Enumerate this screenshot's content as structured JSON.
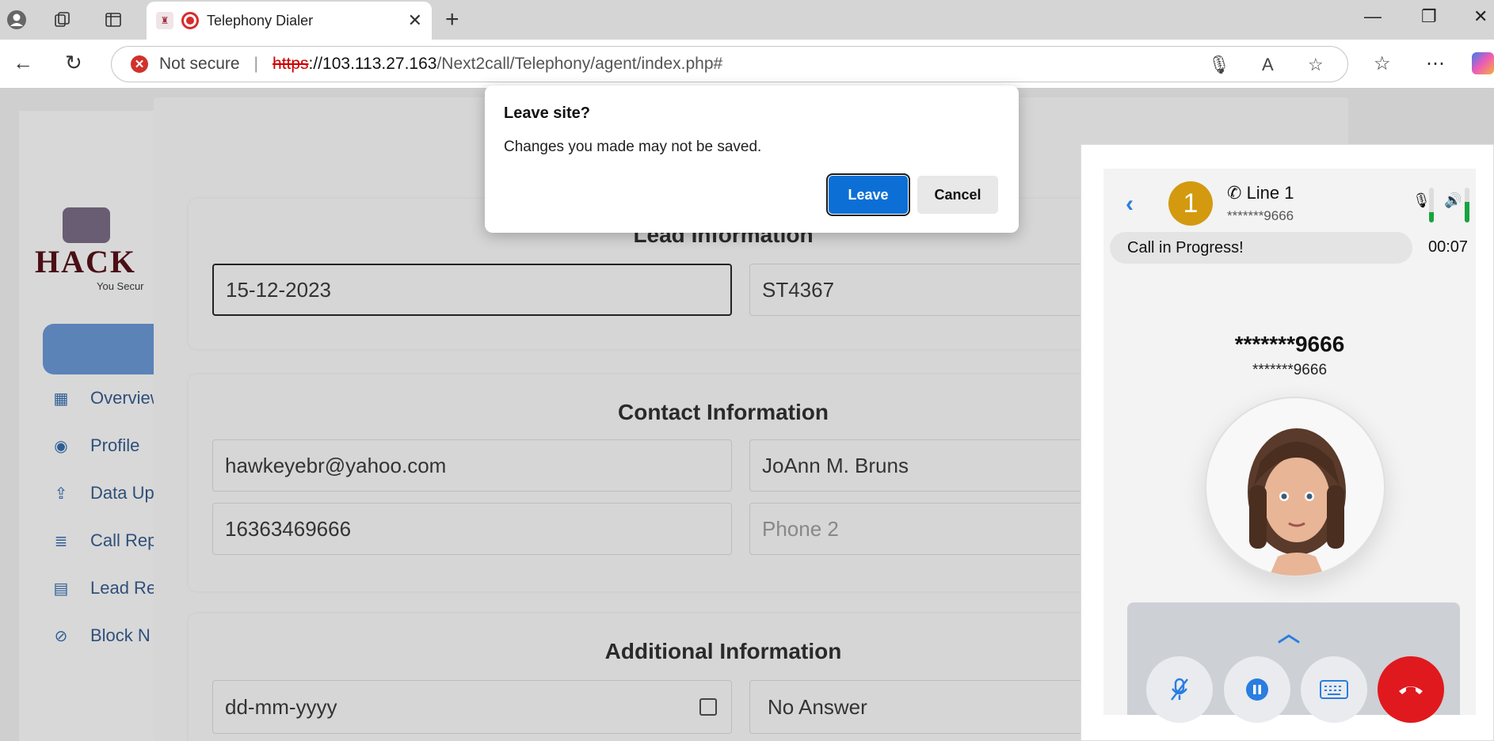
{
  "browser": {
    "tab_title": "Telephony Dialer",
    "url_warning": "Not secure",
    "url_scheme": "https",
    "url_host": "://103.113.27.163",
    "url_path": "/Next2call/Telephony/agent/index.php#"
  },
  "sidebar": {
    "logo_text": "HACK",
    "logo_tagline": "You Secur",
    "items": [
      {
        "label": "Overview",
        "icon": "grid-icon"
      },
      {
        "label": "Profile",
        "icon": "user-circle-icon"
      },
      {
        "label": "Data Up",
        "icon": "upload-icon"
      },
      {
        "label": "Call Rep",
        "icon": "database-icon"
      },
      {
        "label": "Lead Re",
        "icon": "id-card-icon"
      },
      {
        "label": "Block N",
        "icon": "block-icon"
      }
    ]
  },
  "lead": {
    "heading": "Lead Information",
    "date": "15-12-2023",
    "code": "ST4367"
  },
  "contact": {
    "heading": "Contact Information",
    "email": "hawkeyebr@yahoo.com",
    "name": "JoAnn M. Bruns",
    "phone1": "16363469666",
    "phone2_placeholder": "Phone 2"
  },
  "additional": {
    "heading": "Additional Information",
    "date_placeholder": "dd-mm-yyyy",
    "disposition": "No Answer"
  },
  "dialog": {
    "title": "Leave site?",
    "message": "Changes you made may not be saved.",
    "leave_label": "Leave",
    "cancel_label": "Cancel"
  },
  "dialer": {
    "line_number": "1",
    "line_label": "Line 1",
    "line_masked": "*******9666",
    "status": "Call in Progress!",
    "timer": "00:07",
    "caller_main": "*******9666",
    "caller_sub": "*******9666",
    "mic_level": 0.3,
    "speaker_level": 0.6
  }
}
